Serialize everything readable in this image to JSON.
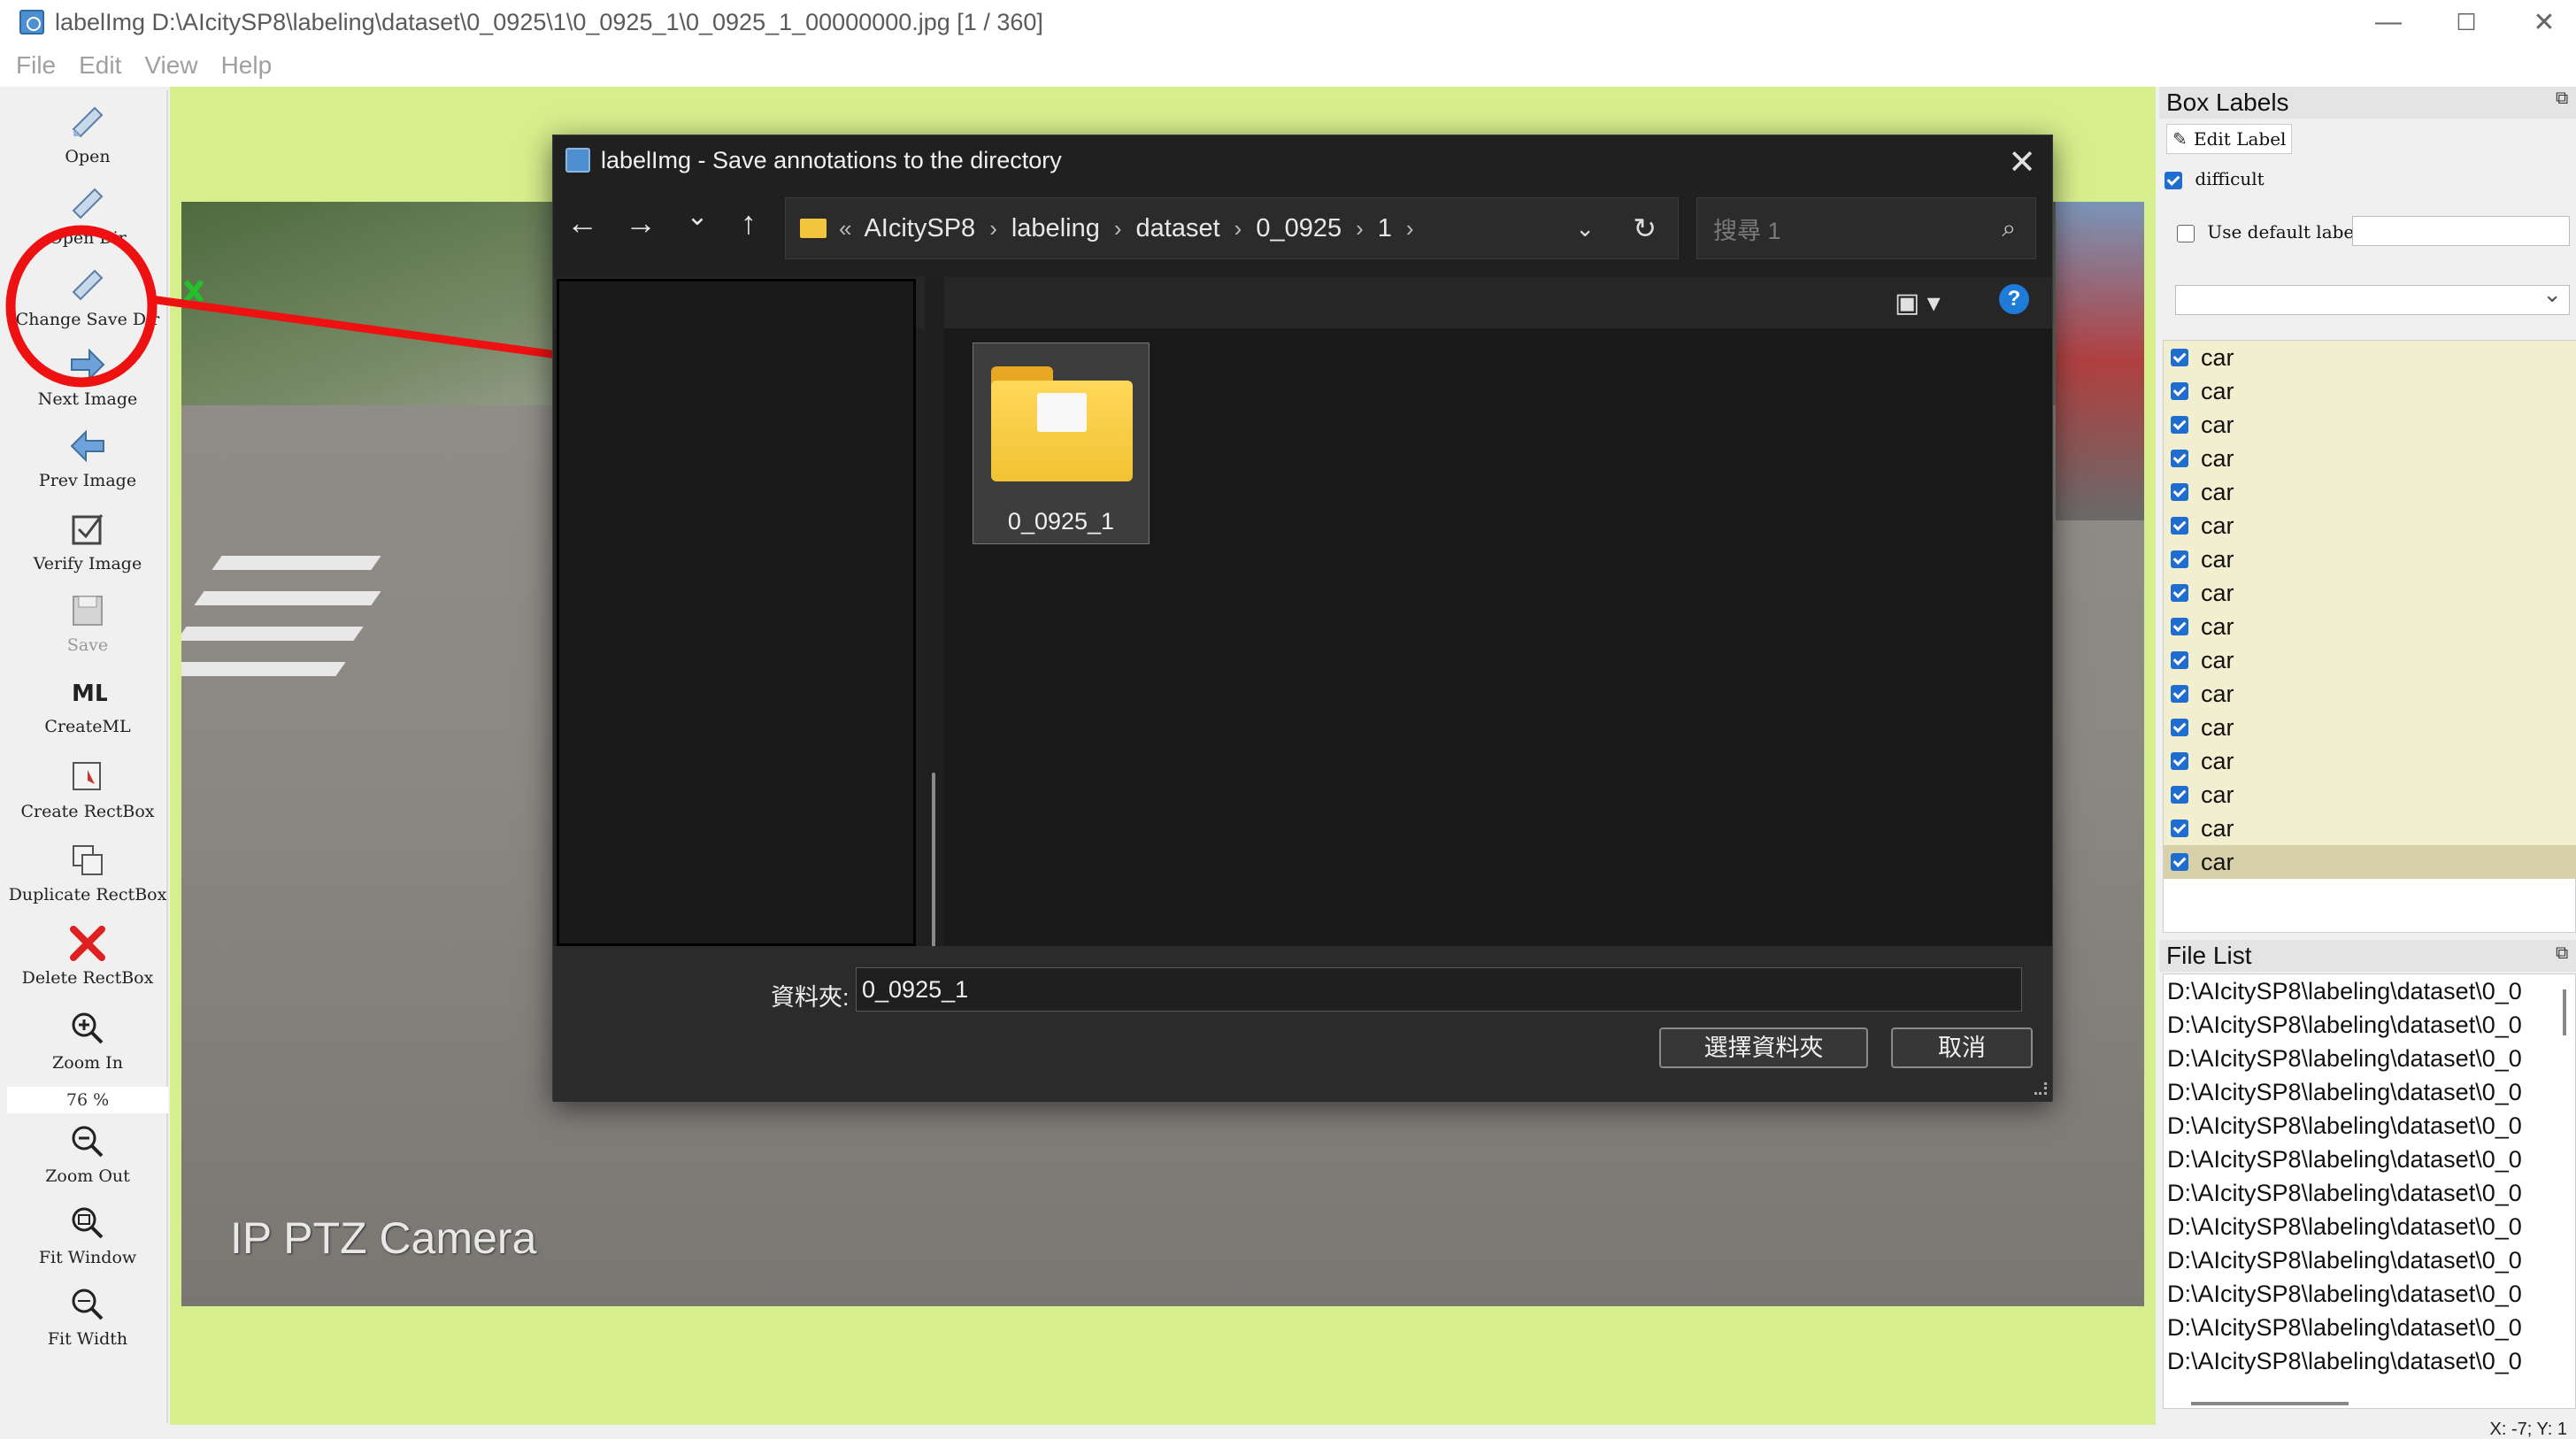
{
  "window": {
    "title": "labelImg D:\\AIcitySP8\\labeling\\dataset\\0_0925\\1\\0_0925_1\\0_0925_1_00000000.jpg [1 / 360]",
    "controls": {
      "minimize": "—",
      "maximize": "☐",
      "close": "✕"
    }
  },
  "menu": [
    "File",
    "Edit",
    "View",
    "Help"
  ],
  "toolbar": {
    "open": "Open",
    "open_dir": "Open Dir",
    "change_save_dir": "Change Save Dir",
    "next_image": "Next Image",
    "prev_image": "Prev Image",
    "verify_image": "Verify Image",
    "save": "Save",
    "createml": "CreateML",
    "create_rectbox": "Create RectBox",
    "duplicate_rectbox": "Duplicate RectBox",
    "delete_rectbox": "Delete RectBox",
    "zoom_in": "Zoom In",
    "zoom_value": "76 %",
    "zoom_out": "Zoom Out",
    "fit_window": "Fit Window",
    "fit_width": "Fit Width"
  },
  "canvas": {
    "camera_label": "IP PTZ Camera"
  },
  "dialog": {
    "title": "labelImg - Save annotations to the directory",
    "close": "✕",
    "nav": {
      "back": "←",
      "forward": "→",
      "recent": "⌄",
      "up": "↑"
    },
    "breadcrumb": {
      "overflow": "«",
      "segments": [
        "AIcitySP8",
        "labeling",
        "dataset",
        "0_0925",
        "1"
      ],
      "separator": "›"
    },
    "address_dropdown": "⌄",
    "refresh": "↻",
    "search_placeholder": "搜尋 1",
    "search_icon": "⌕",
    "view_button": "▣ ▾",
    "help_button": "?",
    "folder_item": "0_0925_1",
    "folder_label": "資料夾:",
    "folder_value": "0_0925_1",
    "select_button": "選擇資料夾",
    "cancel_button": "取消"
  },
  "box_labels": {
    "title": "Box Labels",
    "edit_label": "Edit Label",
    "difficult": "difficult",
    "difficult_checked": true,
    "use_default_label": "Use default label",
    "use_default_checked": false,
    "labels": [
      "car",
      "car",
      "car",
      "car",
      "car",
      "car",
      "car",
      "car",
      "car",
      "car",
      "car",
      "car",
      "car",
      "car",
      "car",
      "car"
    ],
    "selected_index": 15
  },
  "file_list": {
    "title": "File List",
    "items": [
      "D:\\AIcitySP8\\labeling\\dataset\\0_0",
      "D:\\AIcitySP8\\labeling\\dataset\\0_0",
      "D:\\AIcitySP8\\labeling\\dataset\\0_0",
      "D:\\AIcitySP8\\labeling\\dataset\\0_0",
      "D:\\AIcitySP8\\labeling\\dataset\\0_0",
      "D:\\AIcitySP8\\labeling\\dataset\\0_0",
      "D:\\AIcitySP8\\labeling\\dataset\\0_0",
      "D:\\AIcitySP8\\labeling\\dataset\\0_0",
      "D:\\AIcitySP8\\labeling\\dataset\\0_0",
      "D:\\AIcitySP8\\labeling\\dataset\\0_0",
      "D:\\AIcitySP8\\labeling\\dataset\\0_0",
      "D:\\AIcitySP8\\labeling\\dataset\\0_0"
    ]
  },
  "status": "X: -7; Y: 1",
  "colors": {
    "canvas_bg": "#d6ee8c",
    "annotation": "#ee1111",
    "dialog_bg": "#202020",
    "label_row": "#f2eed0",
    "accent": "#1f6ecf"
  }
}
